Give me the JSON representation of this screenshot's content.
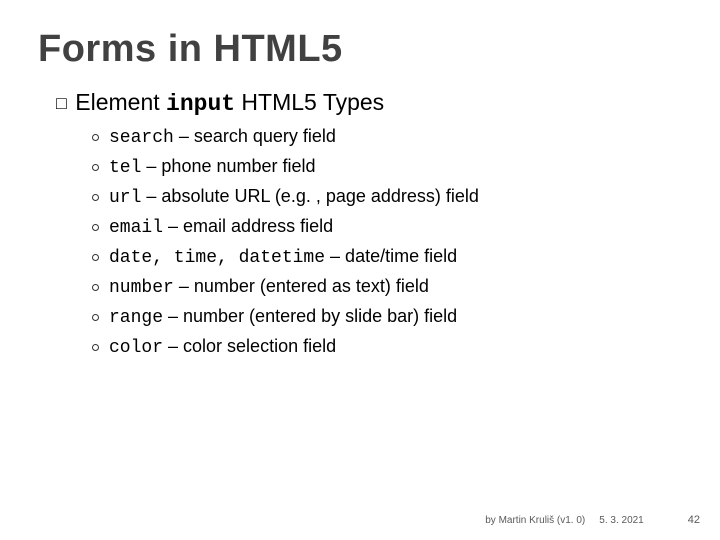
{
  "title": "Forms in HTML5",
  "subtitle": {
    "prefix": "Element ",
    "code": "input",
    "suffix": " HTML5 Types"
  },
  "items": [
    {
      "code": "search",
      "desc": " – search query field"
    },
    {
      "code": "tel",
      "desc": " – phone number field"
    },
    {
      "code": "url",
      "desc": " – absolute URL (e.g. , page address) field"
    },
    {
      "code": "email",
      "desc": " – email address field"
    },
    {
      "code": "date, time, datetime",
      "desc": " – date/time field"
    },
    {
      "code": "number",
      "desc": " – number (entered as text) field"
    },
    {
      "code": "range",
      "desc": " – number (entered by slide bar) field"
    },
    {
      "code": "color",
      "desc": " – color selection field"
    }
  ],
  "footer": {
    "author": "by Martin Kruliš (v1. 0)",
    "date": "5. 3. 2021",
    "page": "42"
  }
}
